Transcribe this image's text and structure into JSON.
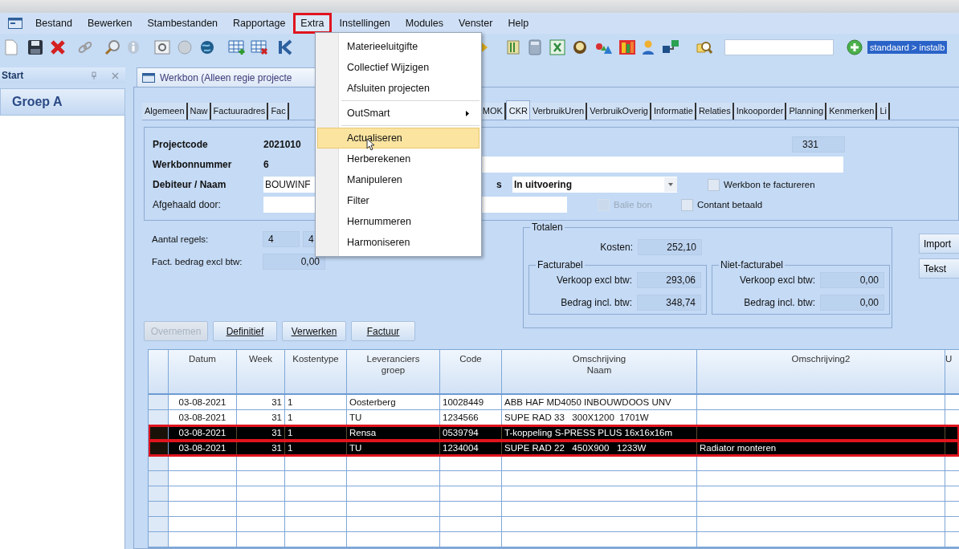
{
  "menu_bar": [
    {
      "label": "Bestand",
      "open": false
    },
    {
      "label": "Bewerken",
      "open": false
    },
    {
      "label": "Stambestanden",
      "open": false
    },
    {
      "label": "Rapportage",
      "open": false
    },
    {
      "label": "Extra",
      "open": true
    },
    {
      "label": "Instellingen",
      "open": false
    },
    {
      "label": "Modules",
      "open": false
    },
    {
      "label": "Venster",
      "open": false
    },
    {
      "label": "Help",
      "open": false
    }
  ],
  "toolbar": {
    "breadcrumb": "standaard > instalb"
  },
  "side_panel": {
    "title": "Start",
    "group": "Groep A"
  },
  "document_tab": "Werkbon (Alleen regie projecte",
  "tabs": [
    {
      "label": "Algemeen",
      "selected": false
    },
    {
      "label": "Naw",
      "selected": false
    },
    {
      "label": "Factuuradres",
      "selected": false
    },
    {
      "label": "Fac",
      "selected": false
    },
    {
      "label": "MOK",
      "selected": false
    },
    {
      "label": "CKR",
      "selected": true
    },
    {
      "label": "VerbruikUren",
      "selected": false
    },
    {
      "label": "VerbruikOverig",
      "selected": false
    },
    {
      "label": "Informatie",
      "selected": false
    },
    {
      "label": "Relaties",
      "selected": false
    },
    {
      "label": "Inkooporder",
      "selected": false
    },
    {
      "label": "Planning",
      "selected": false
    },
    {
      "label": "Kenmerken",
      "selected": false
    },
    {
      "label": "Li",
      "selected": false
    }
  ],
  "form": {
    "projectcode_label": "Projectcode",
    "projectcode": "2021010",
    "project_number": "331",
    "werkbon_label": "Werkbonnummer",
    "werkbon": "6",
    "debiteur_label": "Debiteur / Naam",
    "debiteur": "BOUWINF",
    "status_label": "s",
    "status": "In uitvoering",
    "afgehaald_label": "Afgehaald door:",
    "checkboxes": [
      {
        "label": "Werkbon te factureren",
        "checked": false,
        "disabled": false
      },
      {
        "label": "Balie bon",
        "checked": false,
        "disabled": true
      },
      {
        "label": "Contant betaald",
        "checked": false,
        "disabled": false
      }
    ],
    "aantal_label": "Aantal regels:",
    "aantal_values": [
      "4",
      "4"
    ],
    "fact_label": "Fact. bedrag excl btw:",
    "fact_value": "0,00"
  },
  "totals": {
    "title": "Totalen",
    "kosten_label": "Kosten:",
    "kosten": "252,10",
    "groups": [
      {
        "title": "Facturabel",
        "rows": [
          {
            "label": "Verkoop excl btw:",
            "value": "293,06"
          },
          {
            "label": "Bedrag incl. btw:",
            "value": "348,74"
          }
        ]
      },
      {
        "title": "Niet-facturabel",
        "rows": [
          {
            "label": "Verkoop excl btw:",
            "value": "0,00"
          },
          {
            "label": "Bedrag incl. btw:",
            "value": "0,00"
          }
        ]
      }
    ]
  },
  "side_buttons": [
    "Import",
    "Tekst"
  ],
  "action_buttons": [
    {
      "label": "Overnemen",
      "disabled": true
    },
    {
      "label": "Definitief",
      "disabled": false
    },
    {
      "label": "Verwerken",
      "disabled": false
    },
    {
      "label": "Factuur",
      "disabled": false
    }
  ],
  "grid": {
    "columns": [
      "Datum",
      "Week",
      "Kostentype",
      "Leveranciers\ngroep",
      "Code",
      "Omschrijving\nNaam",
      "Omschrijving2",
      "U"
    ],
    "rows": [
      {
        "selected": false,
        "cells": [
          "03-08-2021",
          "31",
          "1",
          "Oosterberg",
          "10028449",
          "ABB HAF MD4050 INBOUWDOOS UNV",
          ""
        ]
      },
      {
        "selected": false,
        "cells": [
          "03-08-2021",
          "31",
          "1",
          "TU",
          "1234566",
          "SUPE RAD 33   300X1200  1701W",
          ""
        ]
      },
      {
        "selected": true,
        "cells": [
          "03-08-2021",
          "31",
          "1",
          "Rensa",
          "0539794",
          "T-koppeling S-PRESS PLUS 16x16x16m",
          ""
        ]
      },
      {
        "selected": true,
        "cells": [
          "03-08-2021",
          "31",
          "1",
          "TU",
          "1234004",
          "SUPE RAD 22   450X900   1233W",
          "Radiator monteren"
        ]
      }
    ]
  },
  "dropdown": [
    {
      "kind": "item",
      "label": "Materieeluitgifte",
      "highlighted": false
    },
    {
      "kind": "item",
      "label": "Collectief Wijzigen",
      "highlighted": false
    },
    {
      "kind": "item",
      "label": "Afsluiten projecten",
      "highlighted": false
    },
    {
      "kind": "separator"
    },
    {
      "kind": "submenu",
      "label": "OutSmart",
      "highlighted": false
    },
    {
      "kind": "separator"
    },
    {
      "kind": "item",
      "label": "Actualiseren",
      "highlighted": true
    },
    {
      "kind": "item",
      "label": "Herberekenen",
      "highlighted": false
    },
    {
      "kind": "item",
      "label": "Manipuleren",
      "highlighted": false
    },
    {
      "kind": "item",
      "label": "Filter",
      "highlighted": false
    },
    {
      "kind": "item",
      "label": "Hernummeren",
      "highlighted": false
    },
    {
      "kind": "item",
      "label": "Harmoniseren",
      "highlighted": false
    }
  ]
}
